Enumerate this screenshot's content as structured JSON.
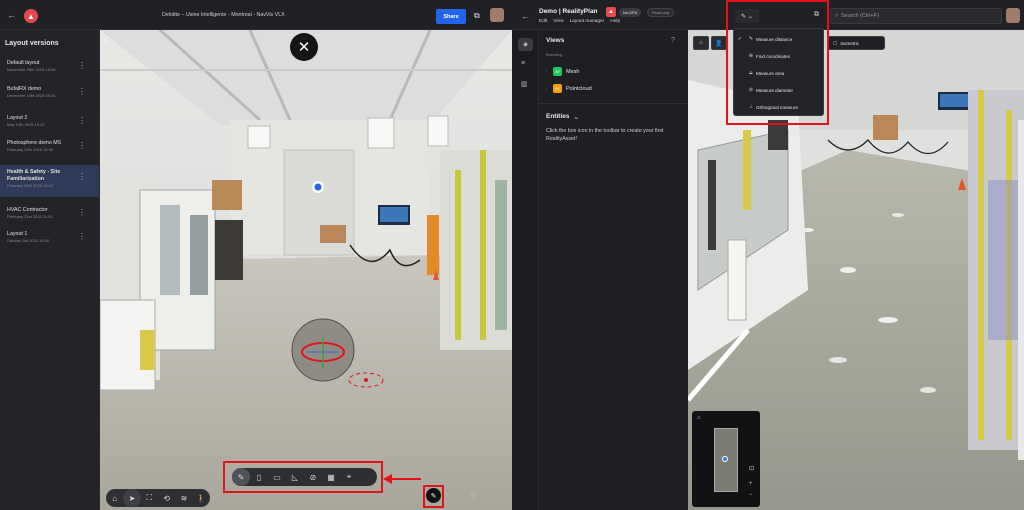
{
  "left": {
    "title": "Deloitte – Usine Intelligente - Montreal - NavVis VLX",
    "share_label": "Share",
    "sidebar_title": "Layout versions",
    "layouts": [
      {
        "name": "Default layout",
        "date": "November 26th 2025 15:08"
      },
      {
        "name": "BufalRX demo",
        "date": "December 19th 2025 09:24"
      },
      {
        "name": "Layout 2",
        "date": "May 19th 2025 15:42"
      },
      {
        "name": "Photosphere demo MS",
        "date": "February 24th 2025 10:30"
      },
      {
        "name": "Health & Safety - Site Familiarization",
        "date": "February 24th 2025 12:24"
      },
      {
        "name": "HVAC Contractor",
        "date": "February 21st 2025 11:53"
      },
      {
        "name": "Layout 1",
        "date": "October 3rd 2024 14:30"
      }
    ],
    "selected_index": 4
  },
  "right": {
    "title": "Demo | RealityPlan",
    "tag_gpu": "No-GPU",
    "tag_readonly": "Read-only",
    "menu": [
      "Edit",
      "View",
      "Layout manager",
      "Help"
    ],
    "search_placeholder": "Search (Ctrl+F)",
    "views_title": "Views",
    "views_subtitle": "Branding",
    "views": [
      {
        "badge": "AF",
        "label": "Mesh",
        "color": "#22c55e"
      },
      {
        "badge": "PC",
        "label": "Pointcloud",
        "color": "#f59e0b"
      }
    ],
    "entities_title": "Entities",
    "entities_text": "Click the box icon in the toolbar to create your first RealityAsset!",
    "measure_menu": [
      {
        "label": "Measure distance",
        "icon": "ruler-icon",
        "checked": true
      },
      {
        "label": "Find coordinates",
        "icon": "crosshair-icon",
        "checked": false
      },
      {
        "label": "Measure area",
        "icon": "area-icon",
        "checked": false
      },
      {
        "label": "Measure diameter",
        "icon": "diameter-icon",
        "checked": false
      },
      {
        "label": "Orthogonal measure",
        "icon": "orthogonal-icon",
        "checked": false
      }
    ],
    "isometric_label": "Isometric"
  },
  "colors": {
    "accent": "#2463eb",
    "highlight_red": "#e0151b",
    "brand_red": "#e5484d",
    "selected_row": "#2f3a58"
  }
}
